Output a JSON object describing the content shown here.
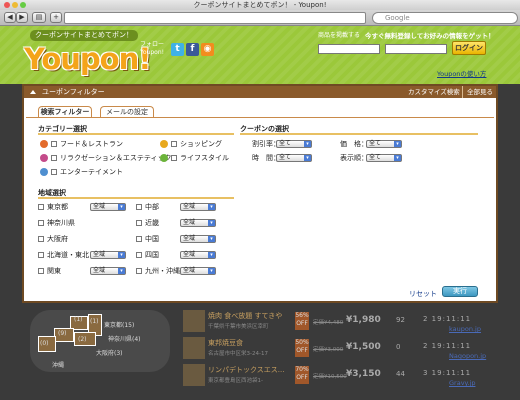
{
  "window": {
    "title": "クーポンサイトまとめてポン！ - Youpon!"
  },
  "browser": {
    "url": "",
    "search_placeholder": "Google",
    "back": "◀",
    "forward": "▶",
    "add": "+"
  },
  "site": {
    "tagline": "クーポンサイトまとめてポン！",
    "logo": "Youpon!",
    "follow": "フォロー\nYoupon!",
    "social": {
      "twitter": "t",
      "facebook": "f",
      "rss": "◉"
    },
    "promo_link": "商品を掲載する",
    "promo_text": "今すぐ無料登録してお好みの情報をゲット！",
    "login": "ログイン",
    "howto": "Youponの使い方"
  },
  "filter": {
    "title": "ユーポンフィルター",
    "custom_link": "カスタマイズ検索",
    "all_link": "全部見る",
    "tabs": [
      "検索フィルター",
      "メールの設定"
    ],
    "category": {
      "title": "カテゴリー選択",
      "items": [
        "フード＆レストラン",
        "ショッピング",
        "リラクゼーション＆エステティック",
        "ライフスタイル",
        "エンターテイメント"
      ]
    },
    "coupon": {
      "title": "クーポンの選択",
      "fields": [
        {
          "label": "割引率：",
          "value": "全て"
        },
        {
          "label": "価　格：",
          "value": "全て"
        },
        {
          "label": "時　間：",
          "value": "全て"
        },
        {
          "label": "表示順：",
          "value": "全て"
        }
      ]
    },
    "region": {
      "title": "地域選択",
      "left": [
        {
          "label": "東京都",
          "value": "全域"
        },
        {
          "label": "神奈川県",
          "value": ""
        },
        {
          "label": "大阪府",
          "value": ""
        },
        {
          "label": "北海道・東北",
          "value": "全域"
        },
        {
          "label": "関東",
          "value": "全域"
        }
      ],
      "right": [
        {
          "label": "中部",
          "value": "全域"
        },
        {
          "label": "近畿",
          "value": "全域"
        },
        {
          "label": "中国",
          "value": "全域"
        },
        {
          "label": "四国",
          "value": "全域"
        },
        {
          "label": "九州・沖縄",
          "value": "全域"
        }
      ]
    },
    "reset": "リセット",
    "run": "実行"
  },
  "map": {
    "labels": [
      "東京都(15)",
      "神奈川県(4)",
      "大阪府(3)",
      "沖縄",
      "(9)",
      "(1)",
      "(1)",
      "(0)",
      "(2)"
    ]
  },
  "deals": [
    {
      "title": "焼肉 食べ放題 すてきや",
      "address": "千葉県千葉市美浜区幸町",
      "off": "56%\nOFF",
      "orig": "定価¥4,480",
      "price": "¥1,980",
      "count": "92",
      "time": "2 19:11:11",
      "site": "kaupon.jp"
    },
    {
      "title": "東邦焼豆食",
      "address": "名古屋市中区栄3-24-17",
      "off": "50%\nOFF",
      "orig": "定価¥3,000",
      "price": "¥1,500",
      "count": "0",
      "time": "2 19:11:11",
      "site": "Nagopon.jp"
    },
    {
      "title": "リンパデトックスエス...",
      "address": "東京都豊島区西池袋1-",
      "off": "70%\nOFF",
      "orig": "定価¥10,500",
      "price": "¥3,150",
      "count": "44",
      "time": "3 19:11:11",
      "site": "Gravy.jp"
    }
  ],
  "colors": {
    "header_green": "#9bc83a",
    "panel_brown": "#8a5a2b",
    "logo_orange": "#f4a41a",
    "run_blue": "#3d97c0"
  }
}
